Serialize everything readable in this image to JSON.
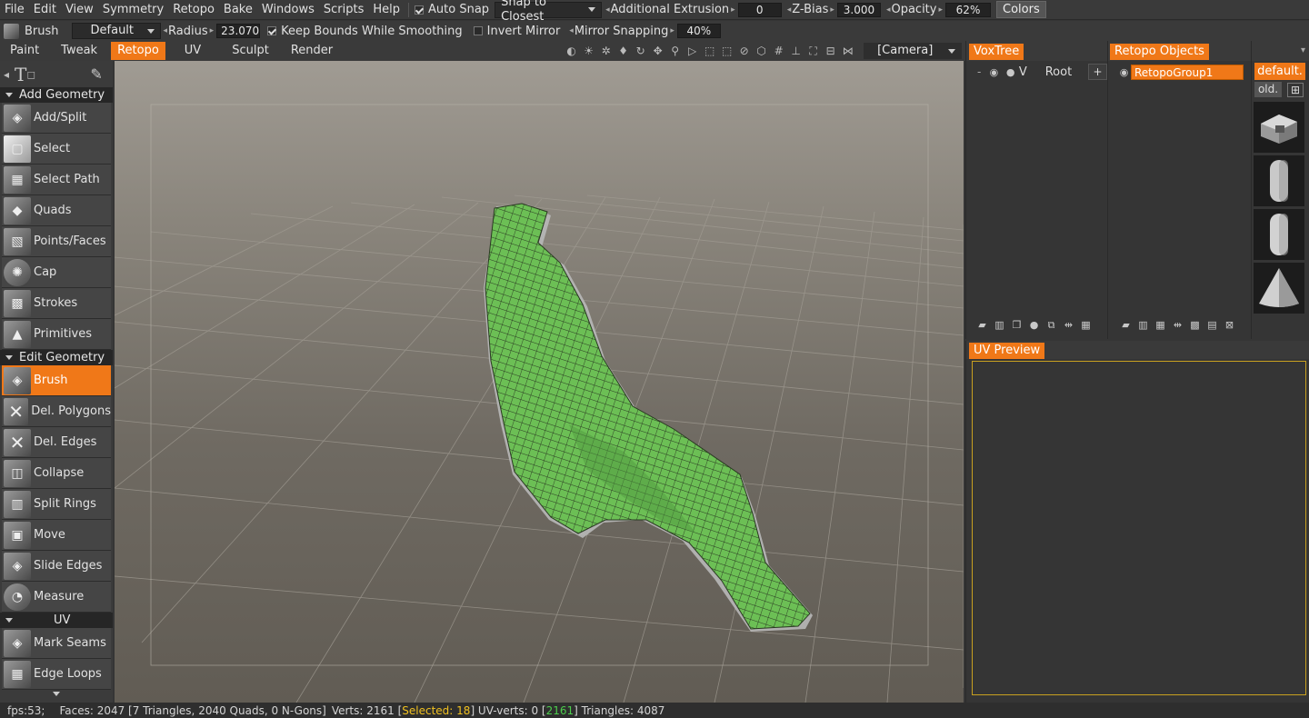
{
  "menubar": {
    "items": [
      "File",
      "Edit",
      "View",
      "Symmetry",
      "Retopo",
      "Bake",
      "Windows",
      "Scripts",
      "Help"
    ],
    "auto_snap": "Auto Snap",
    "snap_mode": "Snap to Closest",
    "additional_extrusion_label": "Additional Extrusion",
    "additional_extrusion_value": "0",
    "z_bias_label": "Z-Bias",
    "z_bias_value": "3.000",
    "opacity_label": "Opacity",
    "opacity_value": "62%",
    "colors_button": "Colors"
  },
  "toolbar2": {
    "tool_name": "Brush",
    "preset": "Default",
    "radius_label": "Radius",
    "radius_value": "23.070",
    "keep_bounds": "Keep Bounds While Smoothing",
    "invert_mirror": "Invert Mirror",
    "mirror_snapping_label": "Mirror Snapping",
    "mirror_snapping_value": "40%"
  },
  "tabs": [
    "Paint",
    "Tweak",
    "Retopo",
    "UV",
    "Sculpt",
    "Render"
  ],
  "active_tab": "Retopo",
  "camera": "[Camera]",
  "left_panel": {
    "add_geometry": "Add Geometry",
    "add_tools": [
      "Add/Split",
      "Select",
      "Select Path",
      "Quads",
      "Points/Faces",
      "Cap",
      "Strokes",
      "Primitives"
    ],
    "edit_geometry": "Edit Geometry",
    "edit_tools": [
      "Brush",
      "Del. Polygons",
      "Del. Edges",
      "Collapse",
      "Split Rings",
      "Move",
      "Slide Edges",
      "Measure"
    ],
    "uv": "UV",
    "uv_tools": [
      "Mark Seams",
      "Edge Loops"
    ]
  },
  "voxtree": {
    "tab": "VoxTree",
    "visibility": "V",
    "root": "Root",
    "add": "+"
  },
  "retopo_objects": {
    "tab": "Retopo Objects",
    "group": "RetopoGroup1"
  },
  "presets": {
    "default_button": "default.",
    "old_button": "old."
  },
  "uv_preview": {
    "tab": "UV Preview"
  },
  "status": {
    "fps": "fps:53;",
    "faces": "Faces: 2047 [7 Triangles, 2040 Quads, 0 N-Gons]",
    "verts": "Verts: 2161 [",
    "selected": "Selected: 18",
    "uv_verts": "] UV-verts: 0 [",
    "uv_count": "2161",
    "triangles": "] Triangles: 4087"
  },
  "colors": {
    "accent": "#f07818",
    "mesh": "#6cbf55",
    "wire": "#2a3a22"
  }
}
